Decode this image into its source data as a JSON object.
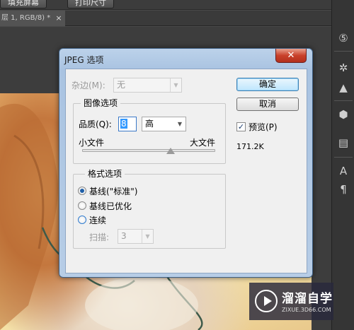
{
  "app": {
    "top_buttons": [
      "填充屏幕",
      "打印尺寸"
    ],
    "document_tab": "层 1, RGB/8) *",
    "tab_close": "×"
  },
  "dialog": {
    "title": "JPEG 选项",
    "close_glyph": "✕",
    "matte_label": "杂边(M):",
    "matte_value": "无",
    "image_options": {
      "legend": "图像选项",
      "quality_label": "品质(Q):",
      "quality_value": "8",
      "quality_level": "高",
      "small_file": "小文件",
      "large_file": "大文件",
      "slider_fraction": 0.667
    },
    "format_options": {
      "legend": "格式选项",
      "options": [
        {
          "label": "基线(\"标准\")",
          "selected": true
        },
        {
          "label": "基线已优化",
          "selected": false
        },
        {
          "label": "连续",
          "selected": false
        }
      ],
      "scans_label": "扫描:",
      "scans_value": "3"
    },
    "ok_label": "确定",
    "cancel_label": "取消",
    "preview_label": "预览(P)",
    "preview_checked": true,
    "file_size": "171.2K"
  },
  "watermark": {
    "title": "溜溜自学",
    "subtitle": "ZIXUE.3D66.COM"
  }
}
